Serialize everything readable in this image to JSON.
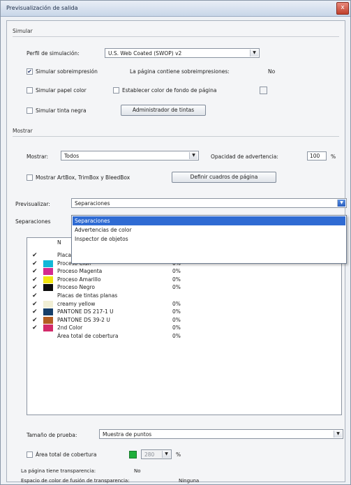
{
  "window": {
    "title": "Previsualización de salida",
    "close_glyph": "x"
  },
  "simular": {
    "section_label": "Simular",
    "perfil_label": "Perfil de simulación:",
    "perfil_value": "U.S. Web Coated (SWOP) v2",
    "sobreimpresion_label": "Simular sobreimpresión",
    "sobreimpresion_checked": true,
    "contiene_label": "La página contiene sobreimpresiones:",
    "contiene_value": "No",
    "papel_label": "Simular papel color",
    "fondo_label": "Establecer color de fondo de página",
    "tinta_negra_label": "Simular tinta negra",
    "admin_tintas_button": "Administrador de tintas"
  },
  "mostrar": {
    "section_label": "Mostrar",
    "mostrar_label": "Mostrar:",
    "mostrar_value": "Todos",
    "opacidad_label": "Opacidad de advertencia:",
    "opacidad_value": "100",
    "opacidad_unit": "%",
    "artbox_label": "Mostrar ArtBox, TrimBox y BleedBox",
    "definir_button": "Definir cuadros de página"
  },
  "previsualizar": {
    "label": "Previsualizar:",
    "value": "Separaciones",
    "options": [
      "Separaciones",
      "Advertencias de color",
      "Inspector de objetos"
    ],
    "selected_index": 0
  },
  "separaciones": {
    "label": "Separaciones",
    "header_partial": "N",
    "rows": [
      {
        "checked": true,
        "color": null,
        "name": "Placas de proceso",
        "pct": ""
      },
      {
        "checked": true,
        "color": "#12b7d8",
        "name": "Proceso Cian",
        "pct": "0%"
      },
      {
        "checked": true,
        "color": "#d42a8f",
        "name": "Proceso Magenta",
        "pct": "0%"
      },
      {
        "checked": true,
        "color": "#f1e410",
        "name": "Proceso Amarillo",
        "pct": "0%"
      },
      {
        "checked": true,
        "color": "#0d0d0d",
        "name": "Proceso Negro",
        "pct": "0%"
      },
      {
        "checked": true,
        "color": null,
        "name": "Placas de tintas planas",
        "pct": ""
      },
      {
        "checked": true,
        "color": "#f1efd5",
        "name": "creamy yellow",
        "pct": "0%"
      },
      {
        "checked": true,
        "color": "#173f69",
        "name": "PANTONE DS 217-1 U",
        "pct": "0%"
      },
      {
        "checked": true,
        "color": "#b45e22",
        "name": "PANTONE DS 39-2 U",
        "pct": "0%"
      },
      {
        "checked": true,
        "color": "#d32a6a",
        "name": "2nd Color",
        "pct": "0%"
      },
      {
        "checked": false,
        "color": null,
        "name": "Área total de cobertura",
        "pct": "0%"
      }
    ]
  },
  "footer": {
    "tamano_label": "Tamaño de prueba:",
    "tamano_value": "Muestra de puntos",
    "area_label": "Área total de cobertura",
    "area_value": "280",
    "area_unit": "%",
    "transparencia_label": "La página tiene transparencia:",
    "transparencia_value": "No",
    "espacio_label": "Espacio de color de fusión de transparencia:",
    "espacio_value": "Ninguna"
  }
}
